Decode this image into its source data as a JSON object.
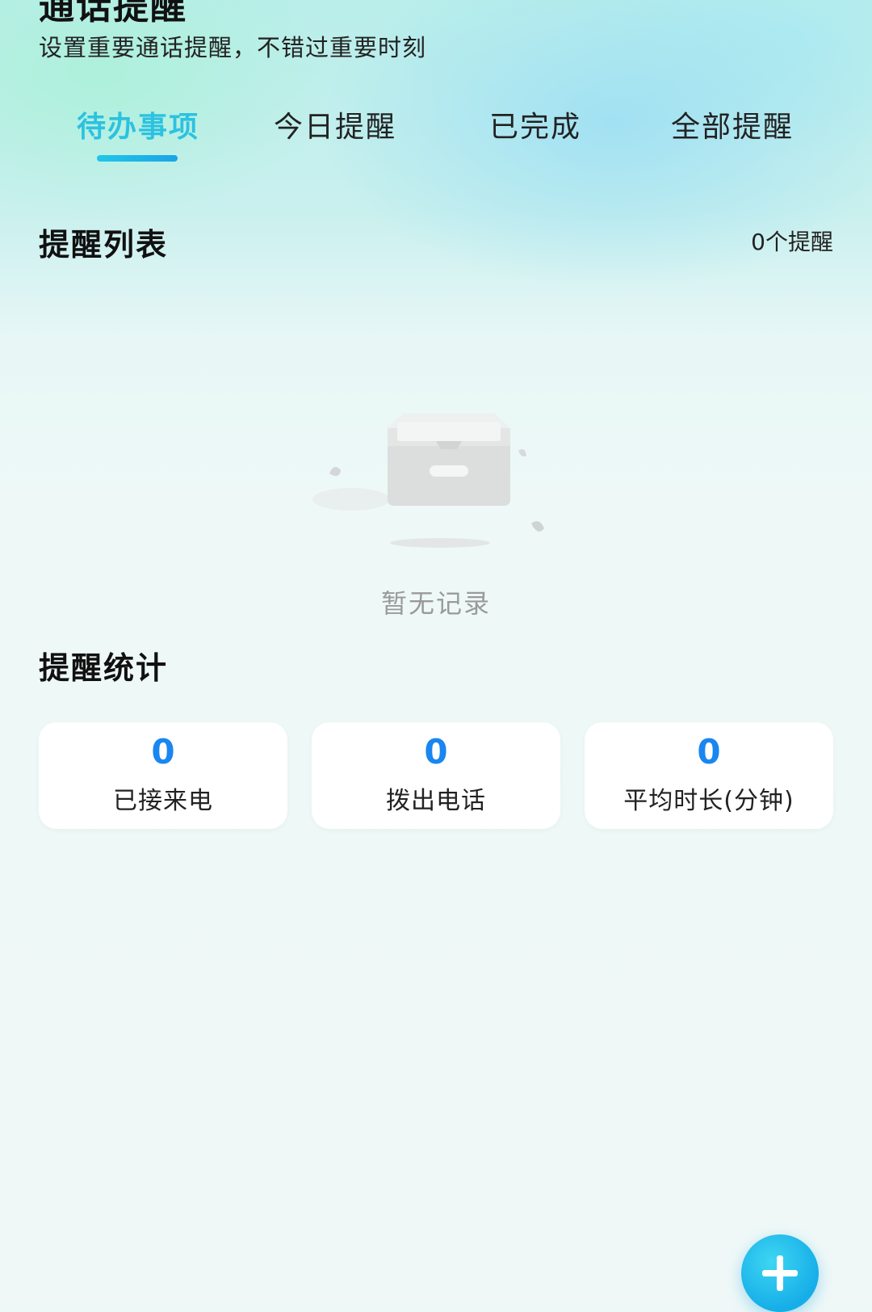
{
  "header": {
    "title": "通话提醒",
    "subtitle": "设置重要通话提醒，不错过重要时刻"
  },
  "tabs": [
    {
      "label": "待办事项",
      "active": true
    },
    {
      "label": "今日提醒",
      "active": false
    },
    {
      "label": "已完成",
      "active": false
    },
    {
      "label": "全部提醒",
      "active": false
    }
  ],
  "reminder_list": {
    "title": "提醒列表",
    "count_label": "0个提醒",
    "empty_text": "暂无记录",
    "empty_icon": "empty-box-icon"
  },
  "stats": {
    "title": "提醒统计",
    "cards": [
      {
        "value": "0",
        "label": "已接来电"
      },
      {
        "value": "0",
        "label": "拨出电话"
      },
      {
        "value": "0",
        "label": "平均时长(分钟)"
      }
    ]
  },
  "fab": {
    "icon": "plus-icon"
  },
  "colors": {
    "accent": "#2cc2e0",
    "stat_value": "#1a86f0",
    "fab": "#16aee8"
  }
}
